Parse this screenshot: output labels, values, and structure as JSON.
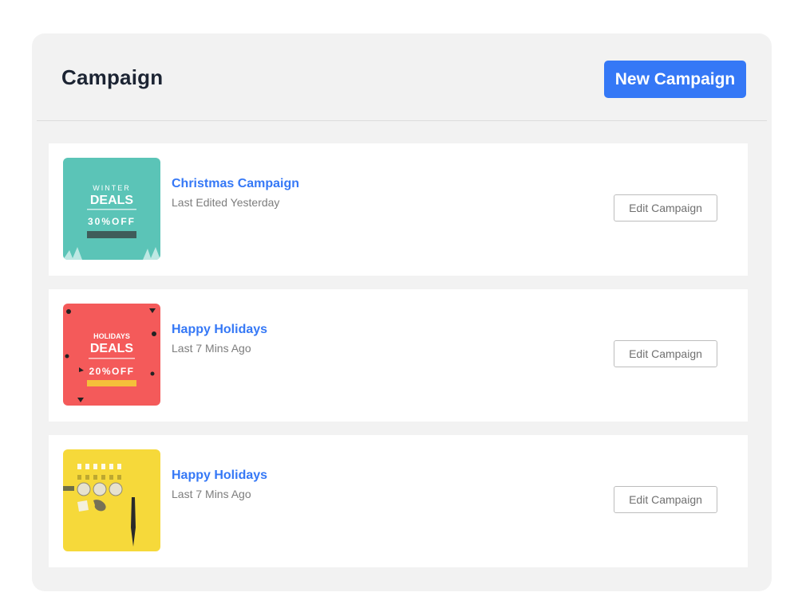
{
  "header": {
    "title": "Campaign",
    "new_button_label": "New Campaign"
  },
  "campaigns": [
    {
      "name": "Christmas Campaign",
      "meta": "Last Edited Yesterday",
      "edit_label": "Edit Campaign",
      "thumb": {
        "line1": "WINTER",
        "line2": "DEALS",
        "line3": "30%OFF",
        "bg": "#5bc4b7"
      }
    },
    {
      "name": "Happy Holidays",
      "meta": "Last 7 Mins Ago",
      "edit_label": "Edit Campaign",
      "thumb": {
        "line1": "HOLIDAYS",
        "line2": "DEALS",
        "line3": "20%OFF",
        "bg": "#f45a5a"
      }
    },
    {
      "name": "Happy Holidays",
      "meta": "Last 7 Mins Ago",
      "edit_label": "Edit Campaign",
      "thumb": {
        "bg": "#f6d93a"
      }
    }
  ],
  "colors": {
    "accent": "#3578f6",
    "panel": "#f2f2f2",
    "title": "#1c2433"
  }
}
